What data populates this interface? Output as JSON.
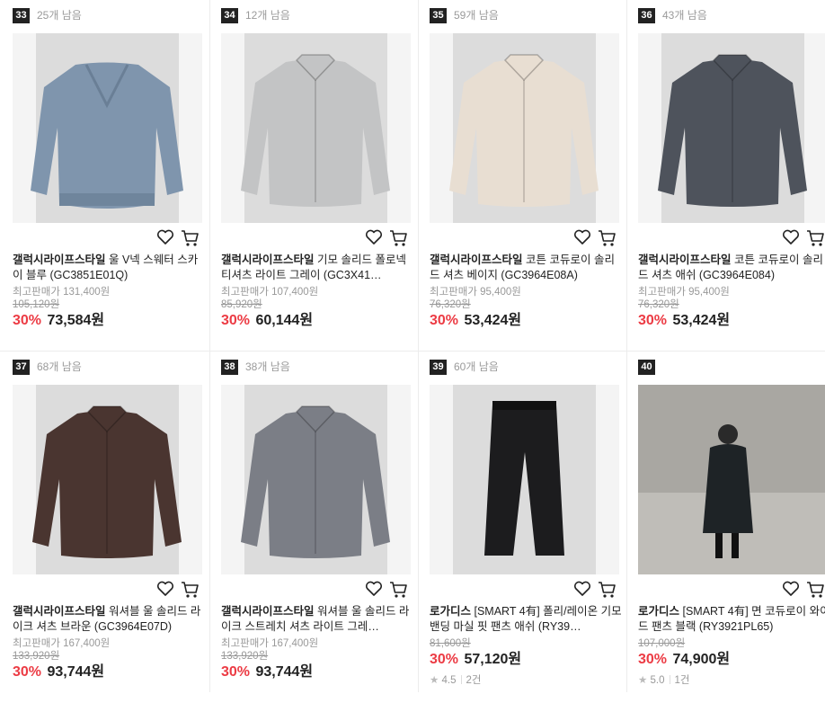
{
  "products": [
    {
      "rank": "33",
      "stock": "25개 남음",
      "brand": "갤럭시라이프스타일",
      "name": "울 V넥 스웨터 스카이 블루 (GC3851E01Q)",
      "max_price": "최고판매가 131,400원",
      "original_price": "105,120원",
      "discount": "30%",
      "price": "73,584원",
      "image": "sweater",
      "color": "#7f95ad"
    },
    {
      "rank": "34",
      "stock": "12개 남음",
      "brand": "갤럭시라이프스타일",
      "name": "기모 솔리드 폴로넥 티셔츠 라이트 그레이 (GC3X41…",
      "max_price": "최고판매가 107,400원",
      "original_price": "85,920원",
      "discount": "30%",
      "price": "60,144원",
      "image": "polo",
      "color": "#c3c4c5"
    },
    {
      "rank": "35",
      "stock": "59개 남음",
      "brand": "갤럭시라이프스타일",
      "name": "코튼 코듀로이 솔리드 셔츠 베이지 (GC3964E08A)",
      "max_price": "최고판매가 95,400원",
      "original_price": "76,320원",
      "discount": "30%",
      "price": "53,424원",
      "image": "shirt",
      "color": "#e8ded2"
    },
    {
      "rank": "36",
      "stock": "43개 남음",
      "brand": "갤럭시라이프스타일",
      "name": "코튼 코듀로이 솔리드 셔츠 애쉬 (GC3964E084)",
      "max_price": "최고판매가 95,400원",
      "original_price": "76,320원",
      "discount": "30%",
      "price": "53,424원",
      "image": "shirt",
      "color": "#4e535c"
    },
    {
      "rank": "37",
      "stock": "68개 남음",
      "brand": "갤럭시라이프스타일",
      "name": "워셔블 울 솔리드 라이크 셔츠 브라운 (GC3964E07D)",
      "max_price": "최고판매가 167,400원",
      "original_price": "133,920원",
      "discount": "30%",
      "price": "93,744원",
      "image": "shirt",
      "color": "#4a3530"
    },
    {
      "rank": "38",
      "stock": "38개 남음",
      "brand": "갤럭시라이프스타일",
      "name": "워셔블 울 솔리드 라이크 스트레치 셔츠 라이트 그레…",
      "max_price": "최고판매가 167,400원",
      "original_price": "133,920원",
      "discount": "30%",
      "price": "93,744원",
      "image": "shirt",
      "color": "#7b7e86"
    },
    {
      "rank": "39",
      "stock": "60개 남음",
      "brand": "로가디스",
      "name": "[SMART 4有] 폴리/레이온 기모 밴딩 마실 핏 팬츠 애쉬 (RY39…",
      "max_price": "",
      "original_price": "81,600원",
      "discount": "30%",
      "price": "57,120원",
      "rating": "4.5",
      "reviews": "2건",
      "image": "pants",
      "color": "#1c1c1e"
    },
    {
      "rank": "40",
      "stock": "",
      "brand": "로가디스",
      "name": "[SMART 4有] 면 코듀로이 와이드 팬츠 블랙 (RY3921PL65)",
      "max_price": "",
      "original_price": "107,000원",
      "discount": "30%",
      "price": "74,900원",
      "rating": "5.0",
      "reviews": "1건",
      "image": "model",
      "color": "#1e2326"
    }
  ]
}
